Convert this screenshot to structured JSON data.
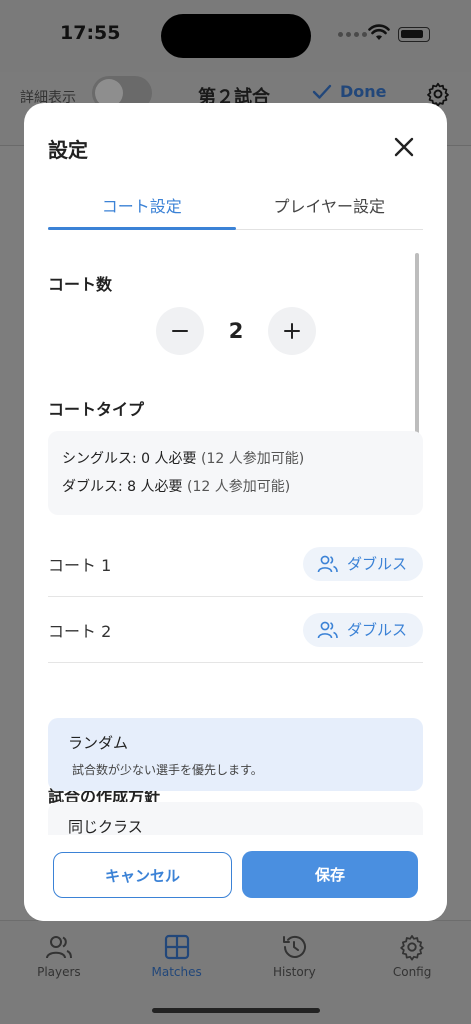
{
  "status_bar": {
    "time": "17:55"
  },
  "app_header": {
    "detail_label": "詳細表示",
    "title": "第２試合",
    "done_label": "Done"
  },
  "tab_bar": {
    "items": [
      {
        "label": "Players",
        "icon": "players-icon"
      },
      {
        "label": "Matches",
        "icon": "matches-icon"
      },
      {
        "label": "History",
        "icon": "history-icon"
      },
      {
        "label": "Config",
        "icon": "gear-icon"
      }
    ],
    "active": "Matches"
  },
  "modal": {
    "title": "設定",
    "tabs": [
      {
        "label": "コート設定",
        "active": true
      },
      {
        "label": "プレイヤー設定",
        "active": false
      }
    ],
    "court_count": {
      "label": "コート数",
      "value": "2"
    },
    "court_type": {
      "label": "コートタイプ",
      "singles": {
        "label": "シングルス: 0 人必要",
        "note": "(12 人参加可能)"
      },
      "doubles": {
        "label": "ダブルス: 8 人必要",
        "note": "(12 人参加可能)"
      }
    },
    "courts": [
      {
        "label": "コート 1",
        "type": "ダブルス"
      },
      {
        "label": "コート 2",
        "type": "ダブルス"
      }
    ],
    "policy": {
      "label": "試合の作成方針",
      "options": [
        {
          "name": "ランダム",
          "desc": "試合数が少ない選手を優先します。",
          "selected": true
        },
        {
          "name": "同じクラス",
          "selected": false
        }
      ]
    },
    "footer": {
      "cancel": "キャンセル",
      "save": "保存"
    }
  },
  "colors": {
    "accent": "#3b82d6",
    "save_button": "#4a8fe0",
    "selected_card": "#e6eefb"
  }
}
